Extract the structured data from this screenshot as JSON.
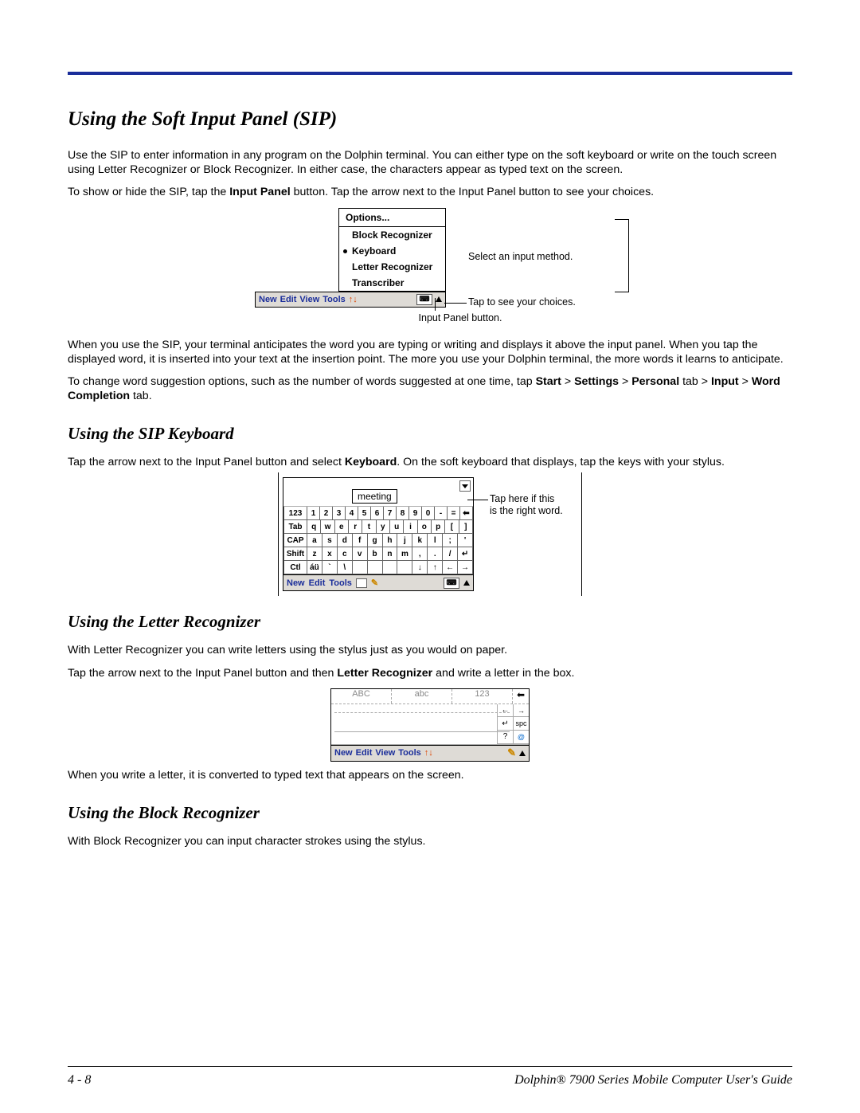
{
  "heading_main": "Using the Soft Input Panel (SIP)",
  "p1a": "Use the SIP to enter information in any program on the Dolphin terminal. You can either type on the soft keyboard or write on the touch screen using Letter Recognizer or Block Recognizer. In either case, the characters appear as typed text on the screen.",
  "p2_pre": "To show or hide the SIP, tap the ",
  "p2_b": "Input Panel",
  "p2_post": " button. Tap the arrow next to the Input Panel button to see your choices.",
  "sip_popup": {
    "options": "Options...",
    "item1": "Block Recognizer",
    "item2": "Keyboard",
    "item3": "Letter Recognizer",
    "item4": "Transcriber"
  },
  "sip_taskbar": {
    "new": "New",
    "edit": "Edit",
    "view": "View",
    "tools": "Tools"
  },
  "ann_select": "Select an input method.",
  "ann_tap": "Tap to see your choices.",
  "ann_ipbtn": "Input Panel button.",
  "p3": "When you use the SIP, your terminal anticipates the word you are typing or writing and displays it above the input panel. When you tap the displayed word, it is inserted into your text at the insertion point. The more you use your Dolphin terminal, the more words it learns to anticipate.",
  "p4_pre": "To change word suggestion options, such as the number of words suggested at one time, tap ",
  "p4_b1": "Start",
  "p4_s1": " > ",
  "p4_b2": "Settings",
  "p4_s2": " > ",
  "p4_b3": "Personal",
  "p4_s3": " tab > ",
  "p4_b4": "Input",
  "p4_s4": " > ",
  "p4_b5": "Word Completion",
  "p4_s5": " tab.",
  "heading_kbd": "Using the SIP Keyboard",
  "pk_pre": "Tap the arrow next to the Input Panel button and select ",
  "pk_b": "Keyboard",
  "pk_post": ". On the soft keyboard that displays, tap the keys with your stylus.",
  "kbd": {
    "suggestion": "meeting",
    "row1": [
      "123",
      "1",
      "2",
      "3",
      "4",
      "5",
      "6",
      "7",
      "8",
      "9",
      "0",
      "-",
      "=",
      "⬅"
    ],
    "row2": [
      "Tab",
      "q",
      "w",
      "e",
      "r",
      "t",
      "y",
      "u",
      "i",
      "o",
      "p",
      "[",
      "]"
    ],
    "row3": [
      "CAP",
      "a",
      "s",
      "d",
      "f",
      "g",
      "h",
      "j",
      "k",
      "l",
      ";",
      "'"
    ],
    "row4": [
      "Shift",
      "z",
      "x",
      "c",
      "v",
      "b",
      "n",
      "m",
      ",",
      ".",
      "/",
      "↵"
    ],
    "row5": [
      "Ctl",
      "áü",
      "`",
      "\\",
      "",
      "",
      "",
      "",
      "↓",
      "↑",
      "←",
      "→"
    ],
    "bar": {
      "new": "New",
      "edit": "Edit",
      "tools": "Tools"
    },
    "ann_line1": "Tap here if this",
    "ann_line2": "is the right word."
  },
  "heading_lr": "Using the Letter Recognizer",
  "plr1": "With Letter Recognizer you can write letters using the stylus just as you would on paper.",
  "plr2_pre": "Tap the arrow next to the Input Panel button and then ",
  "plr2_b": "Letter Recognizer",
  "plr2_post": " and write a letter in the box.",
  "lr": {
    "ABC": "ABC",
    "abc": "abc",
    "n123": "123",
    "bar": {
      "new": "New",
      "edit": "Edit",
      "view": "View",
      "tools": "Tools"
    },
    "side": [
      "←  →",
      "↵  spc",
      "?  @"
    ]
  },
  "plr3": "When you write a letter, it is converted to typed text that appears on the screen.",
  "heading_br": "Using the Block Recognizer",
  "pbr": "With Block Recognizer you can input character strokes using the stylus.",
  "footer": {
    "left": "4 - 8",
    "right": "Dolphin® 7900 Series Mobile Computer User's Guide"
  }
}
